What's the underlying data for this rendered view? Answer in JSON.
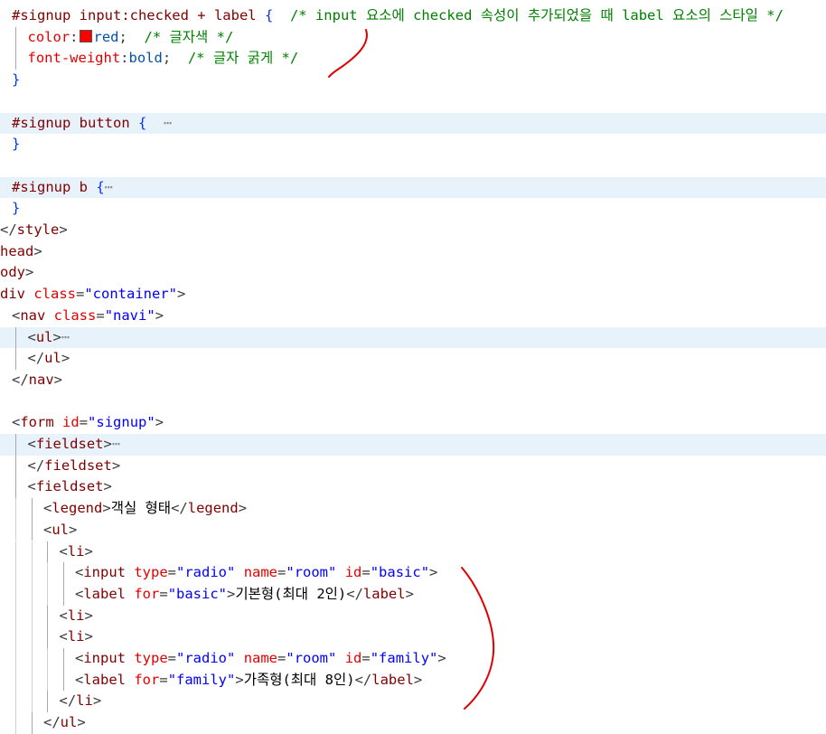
{
  "editor": {
    "lines": [
      {
        "indent": 0,
        "fold": false,
        "segs": [
          {
            "t": "#signup input:checked + label ",
            "c": "c-sel"
          },
          {
            "t": "{",
            "c": "c-brk"
          },
          {
            "t": "  /* input 요소에 checked 속성이 추가되었을 때 label 요소의 스타일 */",
            "c": "c-cmt"
          }
        ]
      },
      {
        "indent": 1,
        "fold": false,
        "segs": [
          {
            "t": "color",
            "c": "c-prop"
          },
          {
            "t": ":",
            "c": "c-pun"
          },
          {
            "sw": "#ff0000"
          },
          {
            "t": "red",
            "c": "c-val"
          },
          {
            "t": ";",
            "c": "c-pun"
          },
          {
            "t": "  /* 글자색 */",
            "c": "c-cmt"
          }
        ]
      },
      {
        "indent": 1,
        "fold": false,
        "segs": [
          {
            "t": "font-weight",
            "c": "c-prop"
          },
          {
            "t": ":",
            "c": "c-pun"
          },
          {
            "t": "bold",
            "c": "c-val"
          },
          {
            "t": ";",
            "c": "c-pun"
          },
          {
            "t": "  /* 글자 굵게 */",
            "c": "c-cmt"
          }
        ]
      },
      {
        "indent": 0,
        "fold": false,
        "segs": [
          {
            "t": "}",
            "c": "c-brk"
          }
        ]
      },
      {
        "indent": 0,
        "fold": false,
        "segs": []
      },
      {
        "indent": 0,
        "fold": true,
        "segs": [
          {
            "t": "#signup button ",
            "c": "c-sel"
          },
          {
            "t": "{",
            "c": "c-brk"
          },
          {
            "t": "  ⋯",
            "c": "c-ell"
          }
        ]
      },
      {
        "indent": 0,
        "fold": false,
        "segs": [
          {
            "t": "}",
            "c": "c-brk"
          }
        ]
      },
      {
        "indent": 0,
        "fold": false,
        "segs": []
      },
      {
        "indent": 0,
        "fold": true,
        "segs": [
          {
            "t": "#signup b ",
            "c": "c-sel"
          },
          {
            "t": "{",
            "c": "c-brk"
          },
          {
            "t": "⋯",
            "c": "c-ell"
          }
        ]
      },
      {
        "indent": 0,
        "fold": false,
        "segs": [
          {
            "t": "}",
            "c": "c-brk"
          }
        ]
      },
      {
        "indent": -1,
        "fold": false,
        "segs": [
          {
            "t": "</",
            "c": "c-pun"
          },
          {
            "t": "style",
            "c": "c-tag"
          },
          {
            "t": ">",
            "c": "c-pun"
          }
        ]
      },
      {
        "indent": -1,
        "fold": false,
        "segs": [
          {
            "t": "head",
            "c": "c-tag"
          },
          {
            "t": ">",
            "c": "c-pun"
          }
        ]
      },
      {
        "indent": -1,
        "fold": false,
        "segs": [
          {
            "t": "ody",
            "c": "c-tag"
          },
          {
            "t": ">",
            "c": "c-pun"
          }
        ]
      },
      {
        "indent": -1,
        "fold": false,
        "segs": [
          {
            "t": "div ",
            "c": "c-tag"
          },
          {
            "t": "class",
            "c": "c-attr"
          },
          {
            "t": "=",
            "c": "c-pun"
          },
          {
            "t": "\"container\"",
            "c": "c-str"
          },
          {
            "t": ">",
            "c": "c-pun"
          }
        ]
      },
      {
        "indent": 0,
        "fold": false,
        "segs": [
          {
            "t": "<",
            "c": "c-pun"
          },
          {
            "t": "nav ",
            "c": "c-tag"
          },
          {
            "t": "class",
            "c": "c-attr"
          },
          {
            "t": "=",
            "c": "c-pun"
          },
          {
            "t": "\"navi\"",
            "c": "c-str"
          },
          {
            "t": ">",
            "c": "c-pun"
          }
        ]
      },
      {
        "indent": 1,
        "fold": true,
        "segs": [
          {
            "t": "<",
            "c": "c-pun"
          },
          {
            "t": "ul",
            "c": "c-tag"
          },
          {
            "t": ">",
            "c": "c-pun"
          },
          {
            "t": "⋯",
            "c": "c-ell"
          }
        ]
      },
      {
        "indent": 1,
        "fold": false,
        "segs": [
          {
            "t": "</",
            "c": "c-pun"
          },
          {
            "t": "ul",
            "c": "c-tag"
          },
          {
            "t": ">",
            "c": "c-pun"
          }
        ]
      },
      {
        "indent": 0,
        "fold": false,
        "segs": [
          {
            "t": "</",
            "c": "c-pun"
          },
          {
            "t": "nav",
            "c": "c-tag"
          },
          {
            "t": ">",
            "c": "c-pun"
          }
        ]
      },
      {
        "indent": 0,
        "fold": false,
        "segs": []
      },
      {
        "indent": 0,
        "fold": false,
        "segs": [
          {
            "t": "<",
            "c": "c-pun"
          },
          {
            "t": "form ",
            "c": "c-tag"
          },
          {
            "t": "id",
            "c": "c-attr"
          },
          {
            "t": "=",
            "c": "c-pun"
          },
          {
            "t": "\"signup\"",
            "c": "c-str"
          },
          {
            "t": ">",
            "c": "c-pun"
          }
        ]
      },
      {
        "indent": 1,
        "fold": true,
        "segs": [
          {
            "t": "<",
            "c": "c-pun"
          },
          {
            "t": "fieldset",
            "c": "c-tag"
          },
          {
            "t": ">",
            "c": "c-pun"
          },
          {
            "t": "⋯",
            "c": "c-ell"
          }
        ]
      },
      {
        "indent": 1,
        "fold": false,
        "segs": [
          {
            "t": "</",
            "c": "c-pun"
          },
          {
            "t": "fieldset",
            "c": "c-tag"
          },
          {
            "t": ">",
            "c": "c-pun"
          }
        ]
      },
      {
        "indent": 1,
        "fold": false,
        "segs": [
          {
            "t": "<",
            "c": "c-pun"
          },
          {
            "t": "fieldset",
            "c": "c-tag"
          },
          {
            "t": ">",
            "c": "c-pun"
          }
        ]
      },
      {
        "indent": 2,
        "fold": false,
        "segs": [
          {
            "t": "<",
            "c": "c-pun"
          },
          {
            "t": "legend",
            "c": "c-tag"
          },
          {
            "t": ">",
            "c": "c-pun"
          },
          {
            "t": "객실 형태",
            "c": "c-txt"
          },
          {
            "t": "</",
            "c": "c-pun"
          },
          {
            "t": "legend",
            "c": "c-tag"
          },
          {
            "t": ">",
            "c": "c-pun"
          }
        ]
      },
      {
        "indent": 2,
        "fold": false,
        "segs": [
          {
            "t": "<",
            "c": "c-pun"
          },
          {
            "t": "ul",
            "c": "c-tag"
          },
          {
            "t": ">",
            "c": "c-pun"
          }
        ]
      },
      {
        "indent": 3,
        "fold": false,
        "segs": [
          {
            "t": "<",
            "c": "c-pun"
          },
          {
            "t": "li",
            "c": "c-tag"
          },
          {
            "t": ">",
            "c": "c-pun"
          }
        ]
      },
      {
        "indent": 4,
        "fold": false,
        "segs": [
          {
            "t": "<",
            "c": "c-pun"
          },
          {
            "t": "input ",
            "c": "c-tag"
          },
          {
            "t": "type",
            "c": "c-attr"
          },
          {
            "t": "=",
            "c": "c-pun"
          },
          {
            "t": "\"radio\"",
            "c": "c-str"
          },
          {
            "t": " ",
            "c": "c-txt"
          },
          {
            "t": "name",
            "c": "c-attr"
          },
          {
            "t": "=",
            "c": "c-pun"
          },
          {
            "t": "\"room\"",
            "c": "c-str"
          },
          {
            "t": " ",
            "c": "c-txt"
          },
          {
            "t": "id",
            "c": "c-attr"
          },
          {
            "t": "=",
            "c": "c-pun"
          },
          {
            "t": "\"basic\"",
            "c": "c-str"
          },
          {
            "t": ">",
            "c": "c-pun"
          }
        ]
      },
      {
        "indent": 4,
        "fold": false,
        "segs": [
          {
            "t": "<",
            "c": "c-pun"
          },
          {
            "t": "label ",
            "c": "c-tag"
          },
          {
            "t": "for",
            "c": "c-attr"
          },
          {
            "t": "=",
            "c": "c-pun"
          },
          {
            "t": "\"basic\"",
            "c": "c-str"
          },
          {
            "t": ">",
            "c": "c-pun"
          },
          {
            "t": "기본형(최대 2인)",
            "c": "c-txt"
          },
          {
            "t": "</",
            "c": "c-pun"
          },
          {
            "t": "label",
            "c": "c-tag"
          },
          {
            "t": ">",
            "c": "c-pun"
          }
        ]
      },
      {
        "indent": 3,
        "fold": false,
        "segs": [
          {
            "t": "<",
            "c": "c-pun"
          },
          {
            "t": "li",
            "c": "c-tag"
          },
          {
            "t": ">",
            "c": "c-pun"
          }
        ]
      },
      {
        "indent": 3,
        "fold": false,
        "segs": [
          {
            "t": "<",
            "c": "c-pun"
          },
          {
            "t": "li",
            "c": "c-tag"
          },
          {
            "t": ">",
            "c": "c-pun"
          }
        ]
      },
      {
        "indent": 4,
        "fold": false,
        "segs": [
          {
            "t": "<",
            "c": "c-pun"
          },
          {
            "t": "input ",
            "c": "c-tag"
          },
          {
            "t": "type",
            "c": "c-attr"
          },
          {
            "t": "=",
            "c": "c-pun"
          },
          {
            "t": "\"radio\"",
            "c": "c-str"
          },
          {
            "t": " ",
            "c": "c-txt"
          },
          {
            "t": "name",
            "c": "c-attr"
          },
          {
            "t": "=",
            "c": "c-pun"
          },
          {
            "t": "\"room\"",
            "c": "c-str"
          },
          {
            "t": " ",
            "c": "c-txt"
          },
          {
            "t": "id",
            "c": "c-attr"
          },
          {
            "t": "=",
            "c": "c-pun"
          },
          {
            "t": "\"family\"",
            "c": "c-str"
          },
          {
            "t": ">",
            "c": "c-pun"
          }
        ]
      },
      {
        "indent": 4,
        "fold": false,
        "segs": [
          {
            "t": "<",
            "c": "c-pun"
          },
          {
            "t": "label ",
            "c": "c-tag"
          },
          {
            "t": "for",
            "c": "c-attr"
          },
          {
            "t": "=",
            "c": "c-pun"
          },
          {
            "t": "\"family\"",
            "c": "c-str"
          },
          {
            "t": ">",
            "c": "c-pun"
          },
          {
            "t": "가족형(최대 8인)",
            "c": "c-txt"
          },
          {
            "t": "</",
            "c": "c-pun"
          },
          {
            "t": "label",
            "c": "c-tag"
          },
          {
            "t": ">",
            "c": "c-pun"
          }
        ]
      },
      {
        "indent": 3,
        "fold": false,
        "segs": [
          {
            "t": "</",
            "c": "c-pun"
          },
          {
            "t": "li",
            "c": "c-tag"
          },
          {
            "t": ">",
            "c": "c-pun"
          }
        ]
      },
      {
        "indent": 2,
        "fold": false,
        "segs": [
          {
            "t": "</",
            "c": "c-pun"
          },
          {
            "t": "ul",
            "c": "c-tag"
          },
          {
            "t": ">",
            "c": "c-pun"
          }
        ]
      }
    ]
  },
  "annotation": {
    "stroke_color": "#e00000"
  },
  "colors": {
    "fold_highlight": "#e8f2fb",
    "swatch": "#ff0000"
  }
}
